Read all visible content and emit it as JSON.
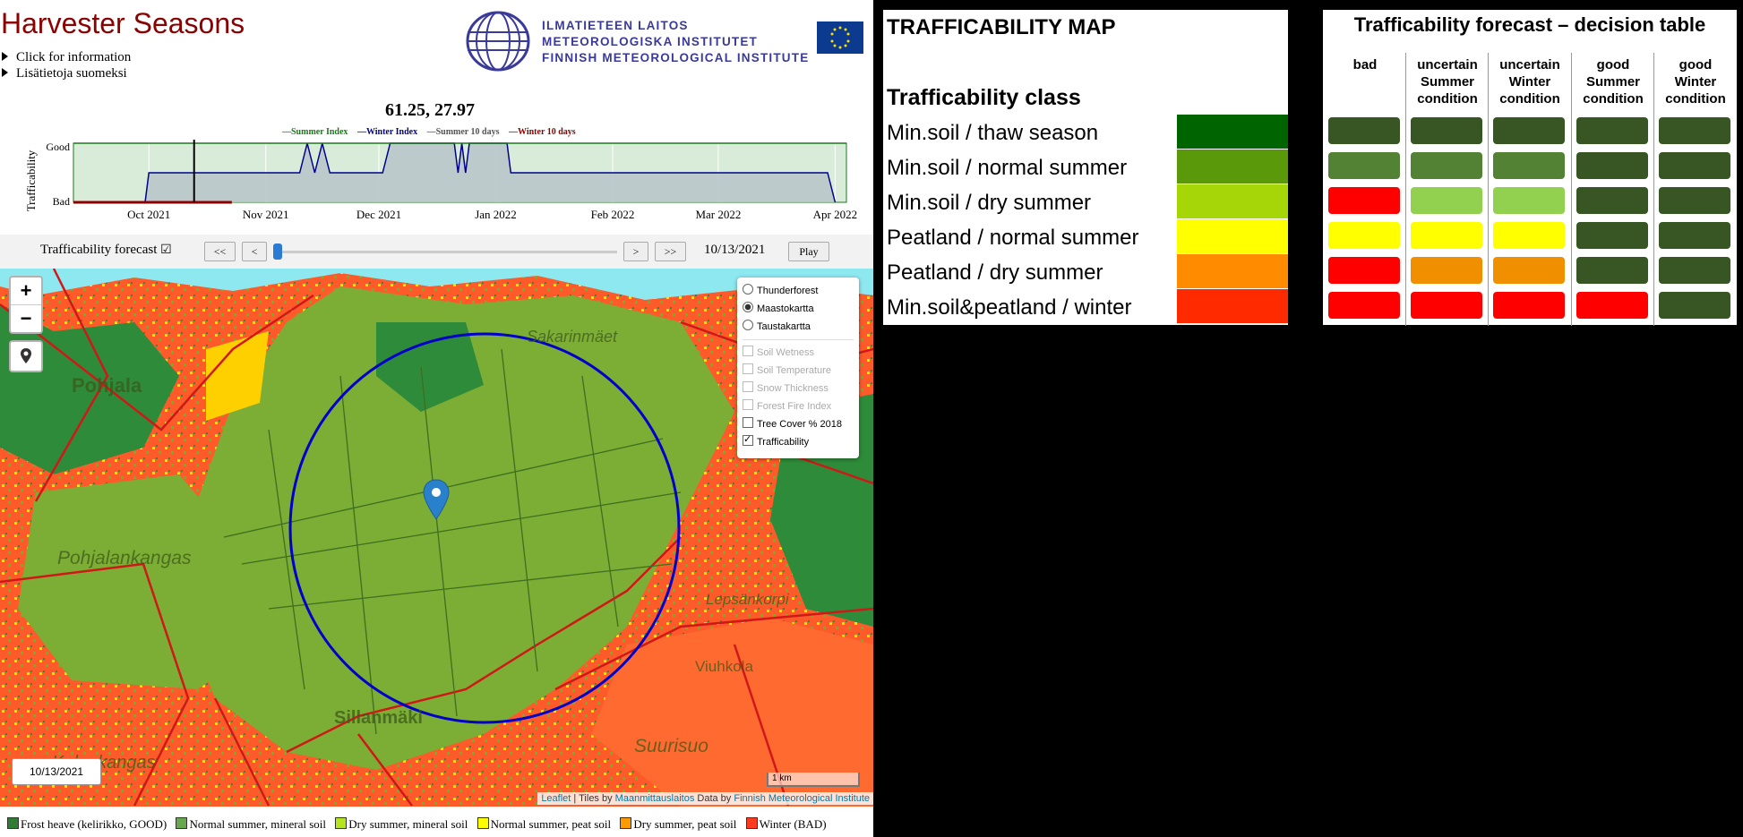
{
  "app": {
    "title": "Harvester Seasons",
    "info_links": [
      "Click for information",
      "Lisätietoja suomeksi"
    ],
    "institute": [
      "ILMATIETEEN LAITOS",
      "METEOROLOGISKA INSTITUTET",
      "FINNISH METEOROLOGICAL INSTITUTE"
    ]
  },
  "chart": {
    "coords": "61.25, 27.97",
    "legend": [
      {
        "label": "Summer Index",
        "color": "#1a7a1a"
      },
      {
        "label": "Winter Index",
        "color": "#00008b"
      },
      {
        "label": "Summer 10 days",
        "color": "#555555"
      },
      {
        "label": "Winter 10 days",
        "color": "#8b0000"
      }
    ],
    "ylabel": "Trafficability",
    "yticks": [
      "Good",
      "Bad"
    ],
    "xticks": [
      "Oct 2021",
      "Nov 2021",
      "Dec 2021",
      "Jan 2022",
      "Feb 2022",
      "Mar 2022",
      "Apr 2022"
    ]
  },
  "chart_data": {
    "type": "line",
    "xlabel": "",
    "ylabel": "Trafficability",
    "x_range": [
      "2021-09-11",
      "2022-04-04"
    ],
    "y_categories": [
      "Bad",
      "Good"
    ],
    "current_date": "2021-10-13",
    "series": [
      {
        "name": "Winter Index",
        "color": "#00008b",
        "points": [
          [
            "2021-09-11",
            0
          ],
          [
            "2021-09-30",
            0
          ],
          [
            "2021-10-01",
            0.5
          ],
          [
            "2021-11-10",
            0.5
          ],
          [
            "2021-11-12",
            1
          ],
          [
            "2021-11-14",
            0.5
          ],
          [
            "2021-11-16",
            1
          ],
          [
            "2021-11-18",
            0.5
          ],
          [
            "2021-12-02",
            0.5
          ],
          [
            "2021-12-04",
            1
          ],
          [
            "2021-12-21",
            1
          ],
          [
            "2021-12-22",
            0.5
          ],
          [
            "2021-12-23",
            1
          ],
          [
            "2021-12-24",
            0.5
          ],
          [
            "2021-12-25",
            1
          ],
          [
            "2022-01-04",
            1
          ],
          [
            "2022-01-05",
            0.5
          ],
          [
            "2022-03-30",
            0.5
          ],
          [
            "2022-04-01",
            0
          ]
        ]
      },
      {
        "name": "Summer Index",
        "color": "#1a7a1a",
        "points": [
          [
            "2021-09-11",
            1
          ],
          [
            "2022-04-04",
            1
          ]
        ]
      },
      {
        "name": "Winter 10 days",
        "color": "#8b0000",
        "points": [
          [
            "2021-09-11",
            0
          ],
          [
            "2021-10-23",
            0
          ]
        ]
      }
    ]
  },
  "controls": {
    "forecast_label": "Trafficability forecast",
    "forecast_checked": true,
    "buttons": {
      "first": "<<",
      "prev": "<",
      "next": ">",
      "last": ">>",
      "play": "Play"
    },
    "date": "10/13/2021",
    "slider_value": 0.0
  },
  "map": {
    "zoom_in": "+",
    "zoom_out": "−",
    "place_names": [
      "Pohjala",
      "Pohjalankangas",
      "Sakarinmäet",
      "Sillanmäki",
      "Viuhkola",
      "Suurisuo",
      "Kalonkangas",
      "Lepsänkorpi"
    ],
    "layers": {
      "base": [
        {
          "label": "Thunderforest",
          "selected": false
        },
        {
          "label": "Maastokartta",
          "selected": true
        },
        {
          "label": "Taustakartta",
          "selected": false
        }
      ],
      "overlays": [
        {
          "label": "Soil Wetness",
          "enabled": false,
          "checked": false
        },
        {
          "label": "Soil Temperature",
          "enabled": false,
          "checked": false
        },
        {
          "label": "Snow Thickness",
          "enabled": false,
          "checked": false
        },
        {
          "label": "Forest Fire Index",
          "enabled": false,
          "checked": false
        },
        {
          "label": "Tree Cover % 2018",
          "enabled": true,
          "checked": false
        },
        {
          "label": "Trafficability",
          "enabled": true,
          "checked": true
        }
      ]
    },
    "date_box": "10/13/2021",
    "scale": "1 km",
    "attribution": {
      "leaflet": "Leaflet",
      "tiles_by": " | Tiles by ",
      "mml": "Maanmittauslaitos",
      "data_by": " Data by ",
      "fmi": "Finnish Meteorological Institute"
    }
  },
  "bottom_legend": [
    {
      "label": "Frost heave (kelirikko, GOOD)",
      "color": "#2e7d32"
    },
    {
      "label": "Normal summer, mineral soil",
      "color": "#6aa84f"
    },
    {
      "label": "Dry summer, mineral soil",
      "color": "#b5e61d"
    },
    {
      "label": "Normal summer, peat soil",
      "color": "#ffff00"
    },
    {
      "label": "Dry summer, peat soil",
      "color": "#ff9900"
    },
    {
      "label": "Winter (BAD)",
      "color": "#ff3b1f"
    }
  ],
  "traffic_map": {
    "title": "TRAFFICABILITY MAP",
    "class_heading": "Trafficability class",
    "classes": [
      {
        "label": "Min.soil / thaw season",
        "color": "#006400"
      },
      {
        "label": "Min.soil / normal summer",
        "color": "#5a9a0a"
      },
      {
        "label": "Min.soil / dry summer",
        "color": "#a6d608"
      },
      {
        "label": "Peatland / normal summer",
        "color": "#ffff00"
      },
      {
        "label": "Peatland / dry summer",
        "color": "#ff8c00"
      },
      {
        "label": "Min.soil&peatland / winter",
        "color": "#ff2a00"
      }
    ]
  },
  "decision_table": {
    "title": "Trafficability forecast – decision table",
    "columns": [
      [
        "bad"
      ],
      [
        "uncertain",
        "Summer",
        "condition"
      ],
      [
        "uncertain",
        "Winter",
        "condition"
      ],
      [
        "good",
        "Summer",
        "condition"
      ],
      [
        "good",
        "Winter",
        "condition"
      ]
    ],
    "cell_colors": [
      [
        "#375623",
        "#375623",
        "#375623",
        "#375623",
        "#375623"
      ],
      [
        "#548235",
        "#548235",
        "#548235",
        "#375623",
        "#375623"
      ],
      [
        "#ff0000",
        "#92d050",
        "#92d050",
        "#375623",
        "#375623"
      ],
      [
        "#ffff00",
        "#ffff00",
        "#ffff00",
        "#375623",
        "#375623"
      ],
      [
        "#ff0000",
        "#f09000",
        "#f09000",
        "#375623",
        "#375623"
      ],
      [
        "#ff0000",
        "#ff0000",
        "#ff0000",
        "#ff0000",
        "#375623"
      ]
    ]
  }
}
